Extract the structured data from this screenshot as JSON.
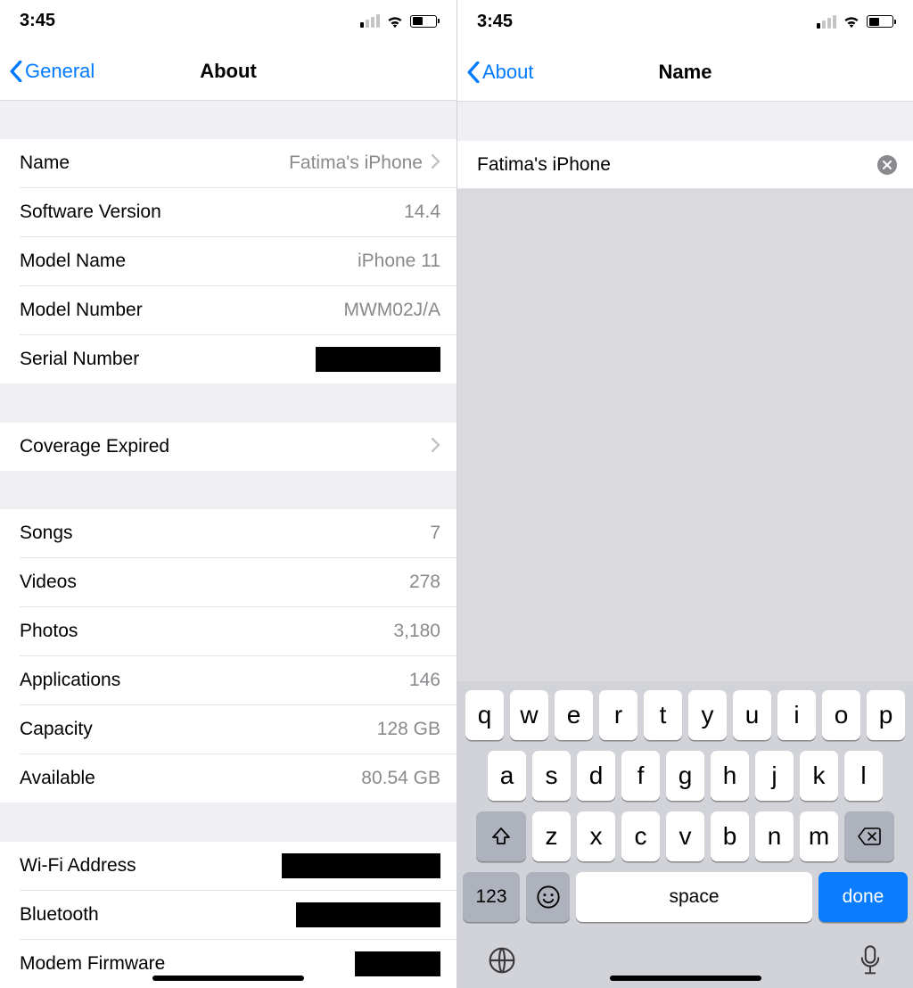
{
  "status": {
    "time": "3:45"
  },
  "left": {
    "nav": {
      "back": "General",
      "title": "About"
    },
    "group1": {
      "name_label": "Name",
      "name_value": "Fatima's iPhone",
      "sw_label": "Software Version",
      "sw_value": "14.4",
      "model_name_label": "Model Name",
      "model_name_value": "iPhone 11",
      "model_num_label": "Model Number",
      "model_num_value": "MWM02J/A",
      "serial_label": "Serial Number"
    },
    "group2": {
      "coverage_label": "Coverage Expired"
    },
    "group3": {
      "songs_label": "Songs",
      "songs_value": "7",
      "videos_label": "Videos",
      "videos_value": "278",
      "photos_label": "Photos",
      "photos_value": "3,180",
      "apps_label": "Applications",
      "apps_value": "146",
      "capacity_label": "Capacity",
      "capacity_value": "128 GB",
      "available_label": "Available",
      "available_value": "80.54 GB"
    },
    "group4": {
      "wifi_label": "Wi-Fi Address",
      "bt_label": "Bluetooth",
      "modem_label": "Modem Firmware"
    }
  },
  "right": {
    "nav": {
      "back": "About",
      "title": "Name"
    },
    "name_value": "Fatima's iPhone"
  },
  "keyboard": {
    "row1": [
      "q",
      "w",
      "e",
      "r",
      "t",
      "y",
      "u",
      "i",
      "o",
      "p"
    ],
    "row2": [
      "a",
      "s",
      "d",
      "f",
      "g",
      "h",
      "j",
      "k",
      "l"
    ],
    "row3": [
      "z",
      "x",
      "c",
      "v",
      "b",
      "n",
      "m"
    ],
    "numbers": "123",
    "space": "space",
    "done": "done"
  }
}
